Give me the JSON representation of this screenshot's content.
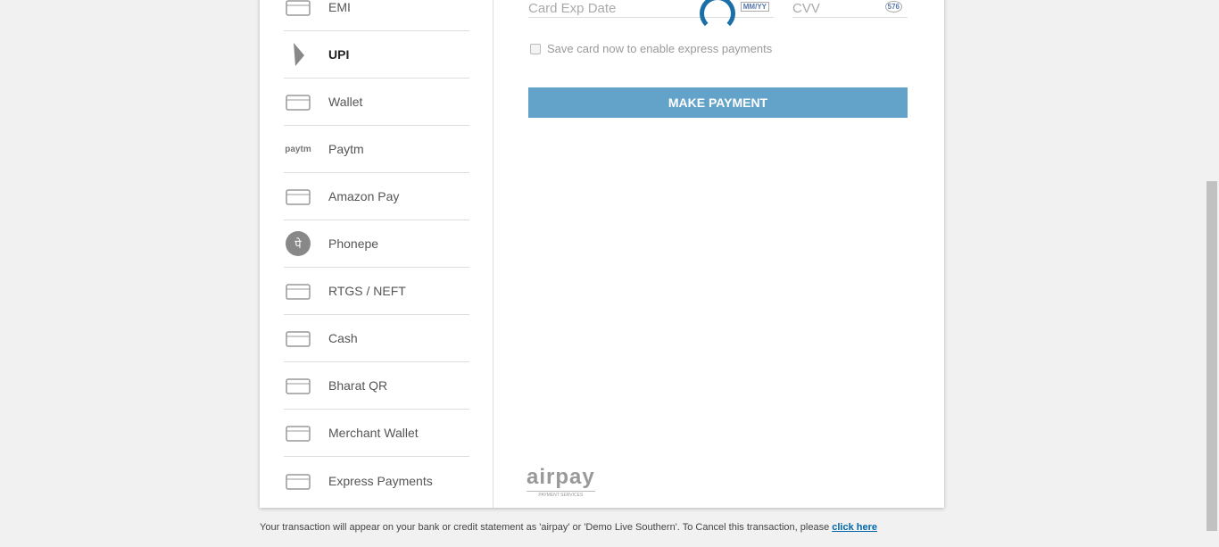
{
  "methods": [
    {
      "label": "EMI",
      "icon": "calculator-icon"
    },
    {
      "label": "UPI",
      "icon": "upi-icon",
      "active": true
    },
    {
      "label": "Wallet",
      "icon": "wallet-icon"
    },
    {
      "label": "Paytm",
      "icon": "paytm-icon",
      "icon_text": "paytm"
    },
    {
      "label": "Amazon Pay",
      "icon": "amazon-pay-icon"
    },
    {
      "label": "Phonepe",
      "icon": "phonepe-icon",
      "icon_text": "पे"
    },
    {
      "label": "RTGS / NEFT",
      "icon": "monitor-icon"
    },
    {
      "label": "Cash",
      "icon": "cash-icon"
    },
    {
      "label": "Bharat QR",
      "icon": "bharat-qr-icon"
    },
    {
      "label": "Merchant Wallet",
      "icon": "wallet-icon"
    },
    {
      "label": "Express Payments",
      "icon": "card-icon"
    }
  ],
  "form": {
    "exp_placeholder": "Card Exp Date",
    "exp_hint": "MM/YY",
    "cvv_placeholder": "CVV",
    "cvv_hint": "576",
    "save_card": "Save card now to enable express payments",
    "submit": "MAKE PAYMENT"
  },
  "logo": {
    "name": "airpay",
    "tagline": "PAYMENT SERVICES"
  },
  "footer": {
    "text": "Your transaction will appear on your bank or credit statement as 'airpay' or 'Demo Live Southern'. To Cancel this transaction, please ",
    "link": "click here"
  }
}
